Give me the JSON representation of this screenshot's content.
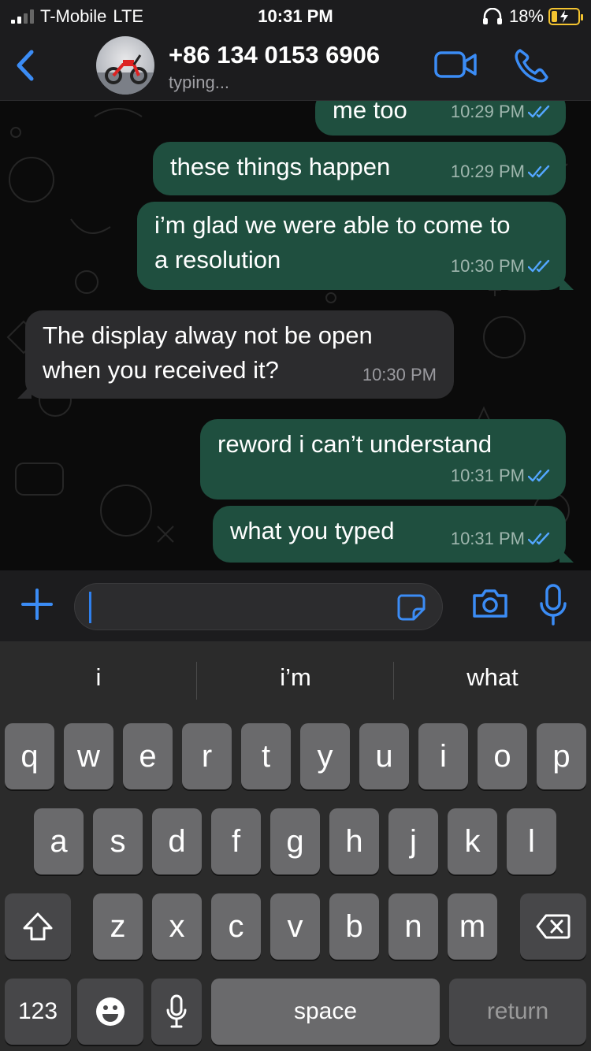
{
  "status_bar": {
    "carrier": "T-Mobile",
    "network": "LTE",
    "time": "10:31 PM",
    "battery_percent": "18%",
    "battery_level": 0.18,
    "icons": [
      "signal-icon",
      "headphones-icon",
      "battery-charging-icon"
    ]
  },
  "header": {
    "contact_name": "+86 134 0153 6906",
    "status": "typing...",
    "icons": [
      "back-chevron-icon",
      "avatar",
      "video-call-icon",
      "phone-call-icon"
    ]
  },
  "messages": [
    {
      "direction": "out",
      "text": "me too",
      "time": "10:29 PM",
      "read": true
    },
    {
      "direction": "out",
      "text": "these things happen",
      "time": "10:29 PM",
      "read": true
    },
    {
      "direction": "out",
      "text_lines": [
        "i’m glad we were able to come to",
        "a resolution"
      ],
      "time": "10:30 PM",
      "read": true
    },
    {
      "direction": "in",
      "text_lines": [
        "The display alway not be open",
        "when you received it?"
      ],
      "time": "10:30 PM"
    },
    {
      "direction": "out",
      "text": "reword i can’t understand",
      "time": "10:31 PM",
      "read": true
    },
    {
      "direction": "out",
      "text": "what you typed",
      "time": "10:31 PM",
      "read": true
    }
  ],
  "input_bar": {
    "value": "",
    "icons": [
      "plus-icon",
      "sticker-icon",
      "camera-icon",
      "microphone-icon"
    ]
  },
  "keyboard": {
    "suggestions": [
      "i",
      "i’m",
      "what"
    ],
    "row1": [
      "q",
      "w",
      "e",
      "r",
      "t",
      "y",
      "u",
      "i",
      "o",
      "p"
    ],
    "row2": [
      "a",
      "s",
      "d",
      "f",
      "g",
      "h",
      "j",
      "k",
      "l"
    ],
    "row3": [
      "z",
      "x",
      "c",
      "v",
      "b",
      "n",
      "m"
    ],
    "numbers_label": "123",
    "space_label": "space",
    "return_label": "return",
    "icons": [
      "shift-icon",
      "delete-icon",
      "emoji-icon",
      "dictation-icon"
    ]
  },
  "colors": {
    "outgoing_bubble": "#1f4f3f",
    "incoming_bubble": "#2c2c2e",
    "accent_blue": "#2f80ed",
    "read_ticks": "#53a6ff",
    "battery": "#f4c430"
  }
}
